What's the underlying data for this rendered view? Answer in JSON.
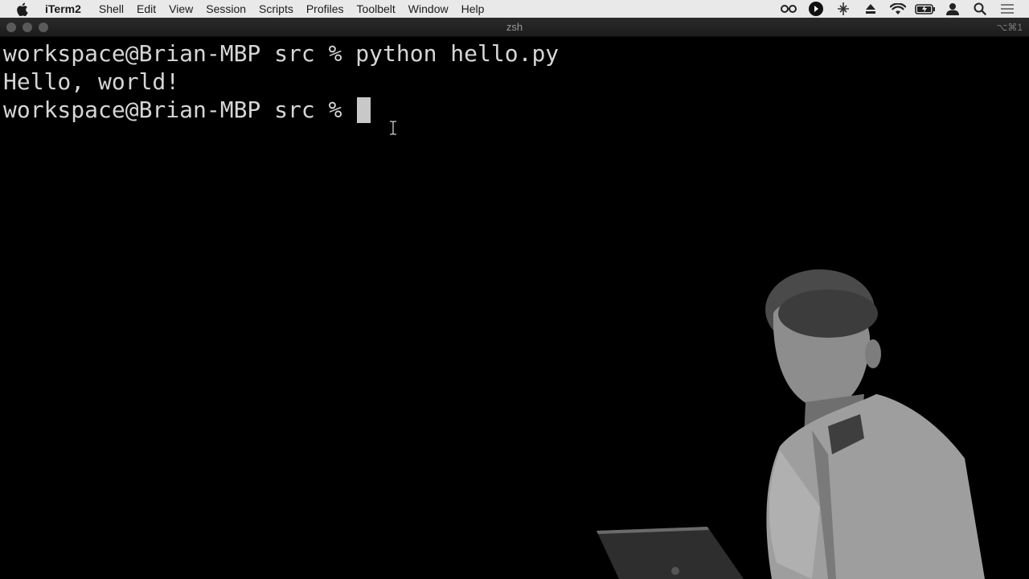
{
  "menubar": {
    "app_name": "iTerm2",
    "items": [
      "Shell",
      "Edit",
      "View",
      "Session",
      "Scripts",
      "Profiles",
      "Toolbelt",
      "Window",
      "Help"
    ],
    "status_icons": [
      "glasses-icon",
      "play-icon",
      "network-icon",
      "eject-icon",
      "wifi-icon",
      "battery-icon",
      "user-icon",
      "search-icon",
      "list-icon"
    ]
  },
  "window": {
    "title": "zsh",
    "shortcut": "⌥⌘1"
  },
  "terminal": {
    "lines": [
      "workspace@Brian-MBP src % python hello.py",
      "Hello, world!",
      "workspace@Brian-MBP src % "
    ]
  },
  "colors": {
    "menubar_bg": "#e9e9e9",
    "terminal_bg": "#000000",
    "terminal_fg": "#d6d6d6"
  }
}
